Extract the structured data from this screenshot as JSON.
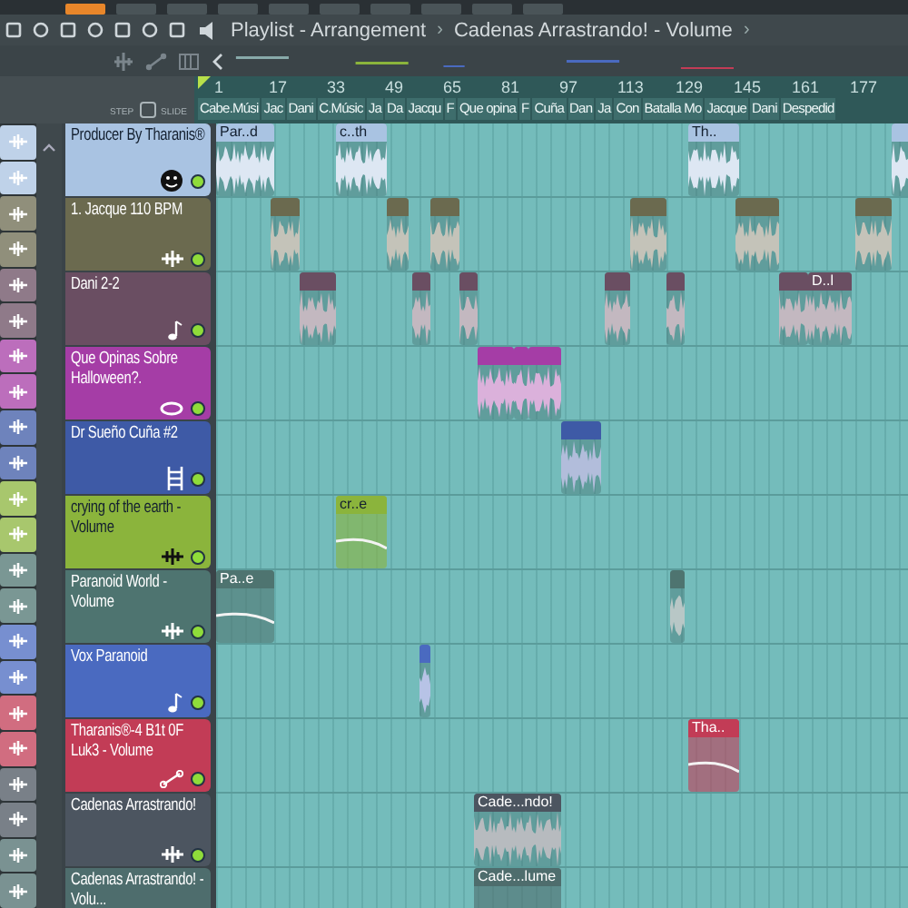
{
  "window": {
    "title": "Playlist - Arrangement",
    "breadcrumb": "Cadenas Arrastrando! - Volume",
    "separator": "›"
  },
  "header_controls": {
    "step_label": "STEP",
    "slide_label": "SLIDE"
  },
  "ruler": {
    "ticks": [
      "1",
      "17",
      "33",
      "49",
      "65",
      "81",
      "97",
      "113",
      "129",
      "145",
      "161",
      "177"
    ],
    "markers": [
      "Cabe.Músi",
      "Jac",
      "Dani",
      "C.Músic",
      "Ja",
      "Da",
      "Jacqu",
      "F",
      "Que opina",
      "F",
      "Cuña",
      "Dan",
      "Ja",
      "Con",
      "Batalla Mo",
      "Jacque",
      "Dani",
      "Despedid"
    ]
  },
  "tracks": [
    {
      "name": "Producer By Tharanis®",
      "color": "#a9c3e2",
      "muted": false,
      "clips": [
        {
          "kind": "audio",
          "label": "Par..d"
        },
        {
          "kind": "audio",
          "label": "c..th"
        },
        {
          "kind": "audio",
          "label": "Th.."
        },
        {
          "kind": "audio"
        }
      ]
    },
    {
      "name": "1. Jacque 110 BPM",
      "color": "#6b6a4f",
      "muted": false,
      "clips": [
        {
          "kind": "audio"
        },
        {
          "kind": "audio"
        },
        {
          "kind": "audio"
        },
        {
          "kind": "audio"
        },
        {
          "kind": "audio"
        },
        {
          "kind": "audio"
        }
      ]
    },
    {
      "name": "Dani 2-2",
      "color": "#6a4e62",
      "muted": false,
      "clips": [
        {
          "kind": "audio"
        },
        {
          "kind": "audio"
        },
        {
          "kind": "audio"
        },
        {
          "kind": "audio"
        },
        {
          "kind": "audio"
        },
        {
          "kind": "audio"
        },
        {
          "kind": "audio",
          "label": "D..l"
        }
      ]
    },
    {
      "name": "Que Opinas Sobre Halloween?.",
      "color": "#a53da6",
      "muted": false,
      "clips": [
        {
          "kind": "audio"
        },
        {
          "kind": "audio"
        },
        {
          "kind": "audio"
        }
      ]
    },
    {
      "name": "Dr Sueño Cuña #2",
      "color": "#3e5aa6",
      "muted": false,
      "clips": [
        {
          "kind": "audio"
        }
      ]
    },
    {
      "name": "crying of the earth - Volume",
      "color": "#8bb43c",
      "muted": false,
      "clips": [
        {
          "kind": "automation",
          "label": "cr..e"
        }
      ]
    },
    {
      "name": "Paranoid World - Volume",
      "color": "#4e7470",
      "muted": false,
      "clips": [
        {
          "kind": "automation",
          "label": "Pa..e"
        },
        {
          "kind": "audio"
        }
      ]
    },
    {
      "name": "Vox Paranoid",
      "color": "#4a6ac0",
      "muted": false,
      "clips": [
        {
          "kind": "audio"
        }
      ]
    },
    {
      "name": "Tharanis®-4 B1t 0F Luk3 - Volume",
      "color": "#c23c56",
      "muted": false,
      "clips": [
        {
          "kind": "automation",
          "label": "Tha.."
        }
      ]
    },
    {
      "name": "Cadenas Arrastrando!",
      "color": "#4c5560",
      "muted": false,
      "clips": [
        {
          "kind": "audio",
          "label": "Cade...ndo!"
        }
      ]
    },
    {
      "name": "Cadenas Arrastrando! - Volu...",
      "color": "#4e6d6d",
      "clips": [
        {
          "kind": "automation",
          "label": "Cade...lume"
        }
      ]
    }
  ]
}
